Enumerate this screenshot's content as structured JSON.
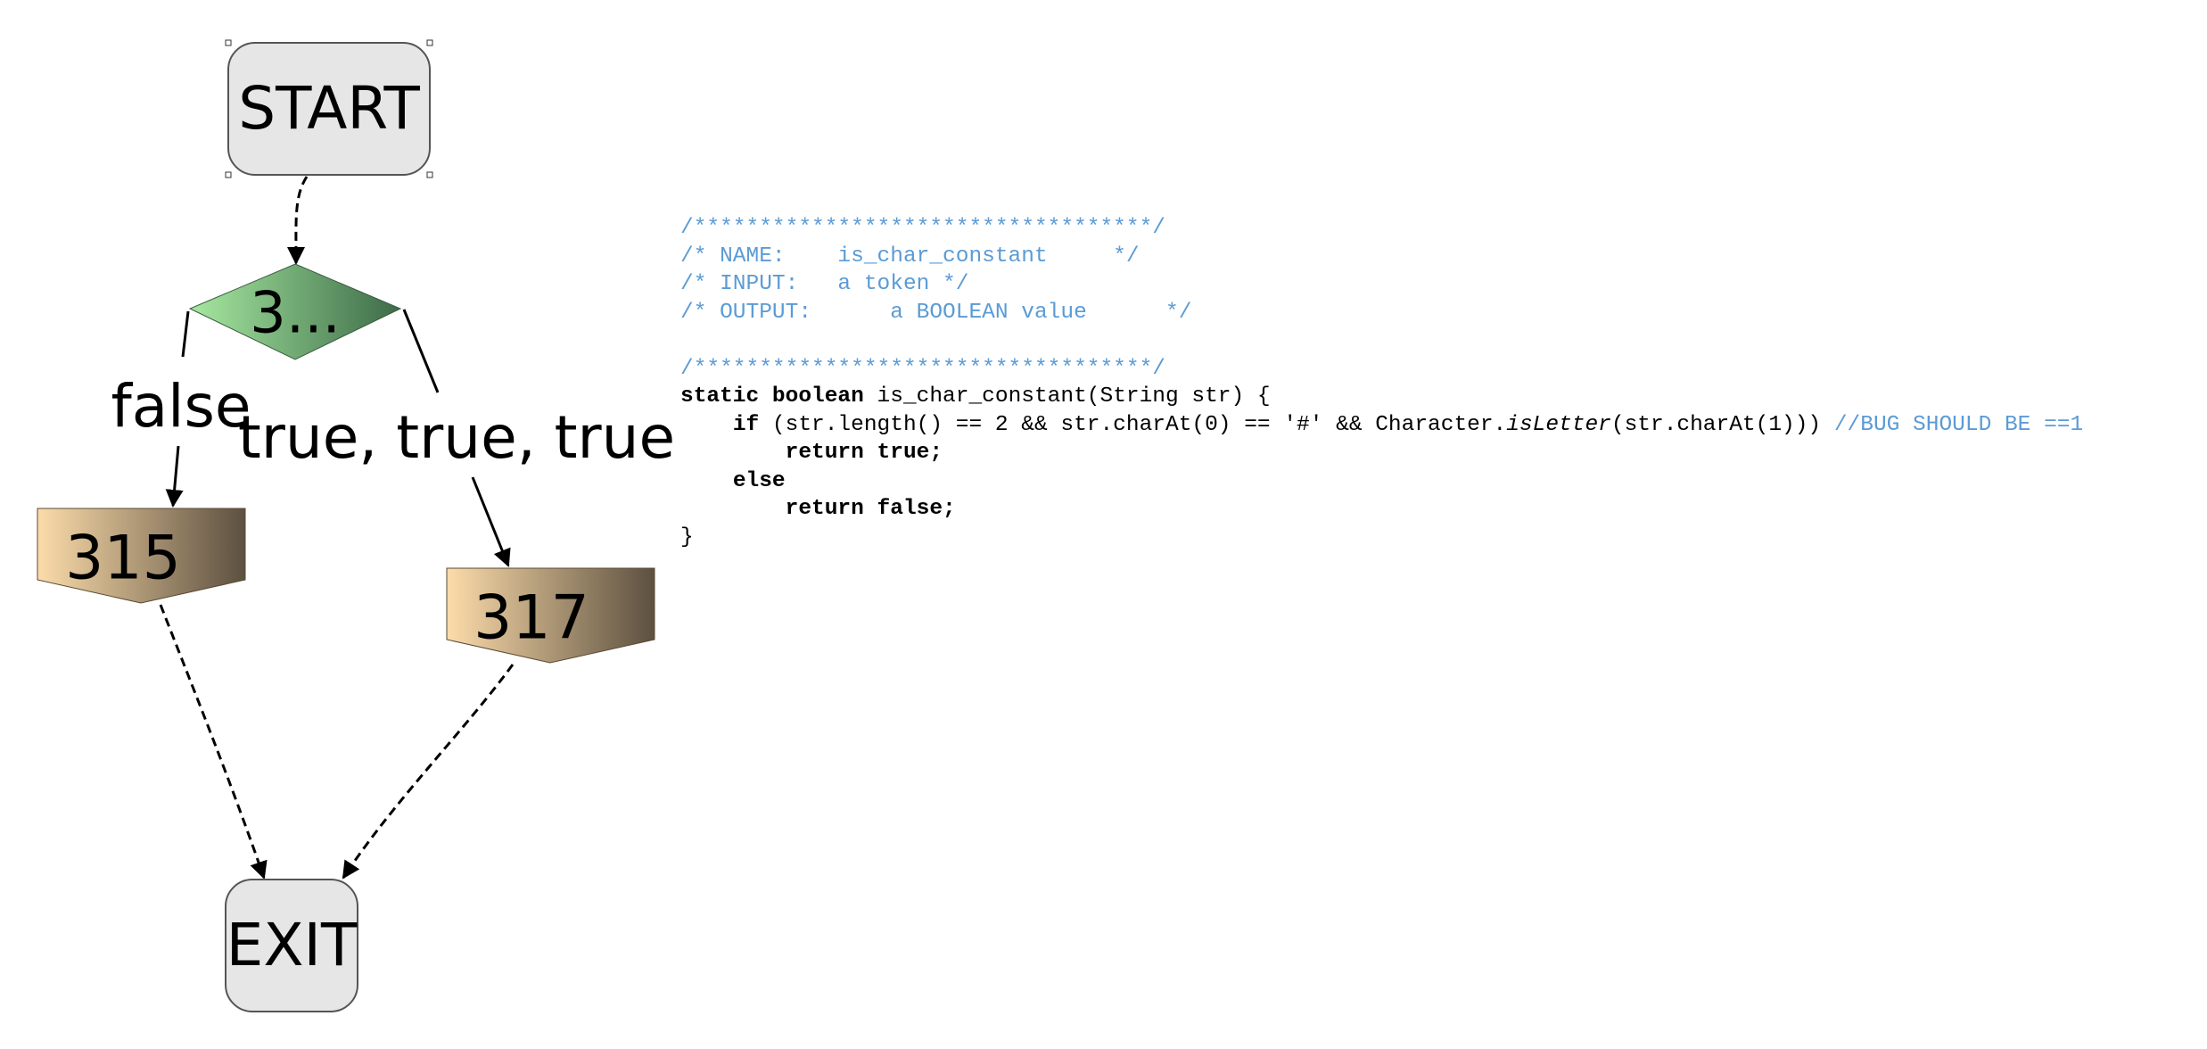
{
  "flowchart": {
    "start_label": "START",
    "decision_label": "3...",
    "false_edge_label": "false",
    "true_edge_label": "true, true, true",
    "node_315_label": "315",
    "node_317_label": "317",
    "exit_label": "EXIT"
  },
  "colors": {
    "terminal_fill": "#e6e6e6",
    "decision_gradient_start": "#a6e8a0",
    "decision_gradient_end": "#3d6b48",
    "block_gradient_start": "#fcdcaa",
    "block_gradient_end": "#5c5040",
    "comment": "#5b9bd5"
  },
  "code": {
    "lines": [
      [
        {
          "t": "/***********************************/",
          "s": "cm"
        }
      ],
      [
        {
          "t": "/* NAME:    is_char_constant     */",
          "s": "cm"
        }
      ],
      [
        {
          "t": "/* INPUT:   a token */",
          "s": "cm"
        }
      ],
      [
        {
          "t": "/* OUTPUT:      a BOOLEAN value      */",
          "s": "cm"
        }
      ],
      [],
      [
        {
          "t": "/***********************************/",
          "s": "cm"
        }
      ],
      [
        {
          "t": "static boolean",
          "s": "kw"
        },
        {
          "t": " is_char_constant(String str) {",
          "s": ""
        }
      ],
      [
        {
          "t": "    ",
          "s": ""
        },
        {
          "t": "if",
          "s": "kw"
        },
        {
          "t": " (str.length() == 2 && str.charAt(0) == '#' && Character.",
          "s": ""
        },
        {
          "t": "isLetter",
          "s": "it"
        },
        {
          "t": "(str.charAt(1))) ",
          "s": ""
        },
        {
          "t": "//BUG SHOULD BE ==1",
          "s": "cm"
        }
      ],
      [
        {
          "t": "        ",
          "s": ""
        },
        {
          "t": "return true;",
          "s": "kw"
        }
      ],
      [
        {
          "t": "    ",
          "s": ""
        },
        {
          "t": "else",
          "s": "kw"
        }
      ],
      [
        {
          "t": "        ",
          "s": ""
        },
        {
          "t": "return false;",
          "s": "kw"
        }
      ],
      [
        {
          "t": "}",
          "s": ""
        }
      ]
    ]
  }
}
